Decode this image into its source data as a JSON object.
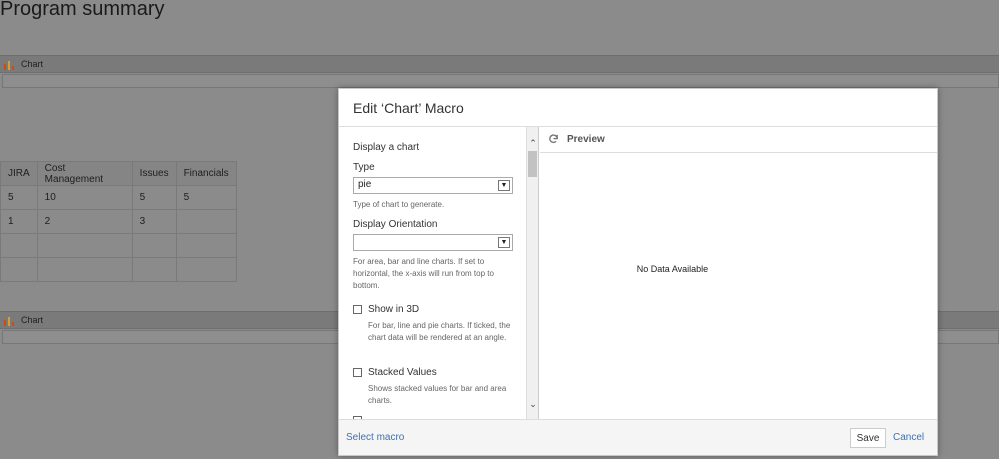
{
  "page": {
    "title": "Program summary",
    "macros": [
      {
        "label": "Chart"
      },
      {
        "label": "Chart"
      }
    ],
    "table": {
      "headers": [
        "JIRA",
        "Cost Management",
        "Issues",
        "Financials"
      ],
      "rows": [
        [
          "5",
          "10",
          "5",
          "5"
        ],
        [
          "1",
          "2",
          "3",
          ""
        ],
        [
          "",
          "",
          "",
          ""
        ],
        [
          "",
          "",
          "",
          ""
        ]
      ]
    }
  },
  "dialog": {
    "title": "Edit ‘Chart’ Macro",
    "section_title": "Display a chart",
    "type": {
      "label": "Type",
      "value": "pie",
      "help": "Type of chart to generate."
    },
    "orientation": {
      "label": "Display Orientation",
      "value": "",
      "help": "For area, bar and line charts. If set to horizontal, the x-axis will run from top to bottom."
    },
    "show3d": {
      "label": "Show in 3D",
      "checked": false,
      "help": "For bar, line and pie charts. If ticked, the chart data will be rendered at an angle."
    },
    "stacked": {
      "label": "Stacked Values",
      "checked": false,
      "help": "Shows stacked values for bar and area charts."
    },
    "preview": {
      "label": "Preview",
      "message": "No Data Available"
    },
    "footer": {
      "select_macro": "Select macro",
      "save": "Save",
      "cancel": "Cancel"
    }
  },
  "colors": {
    "link": "#3b73af",
    "overlay": "#8b8b8b"
  }
}
